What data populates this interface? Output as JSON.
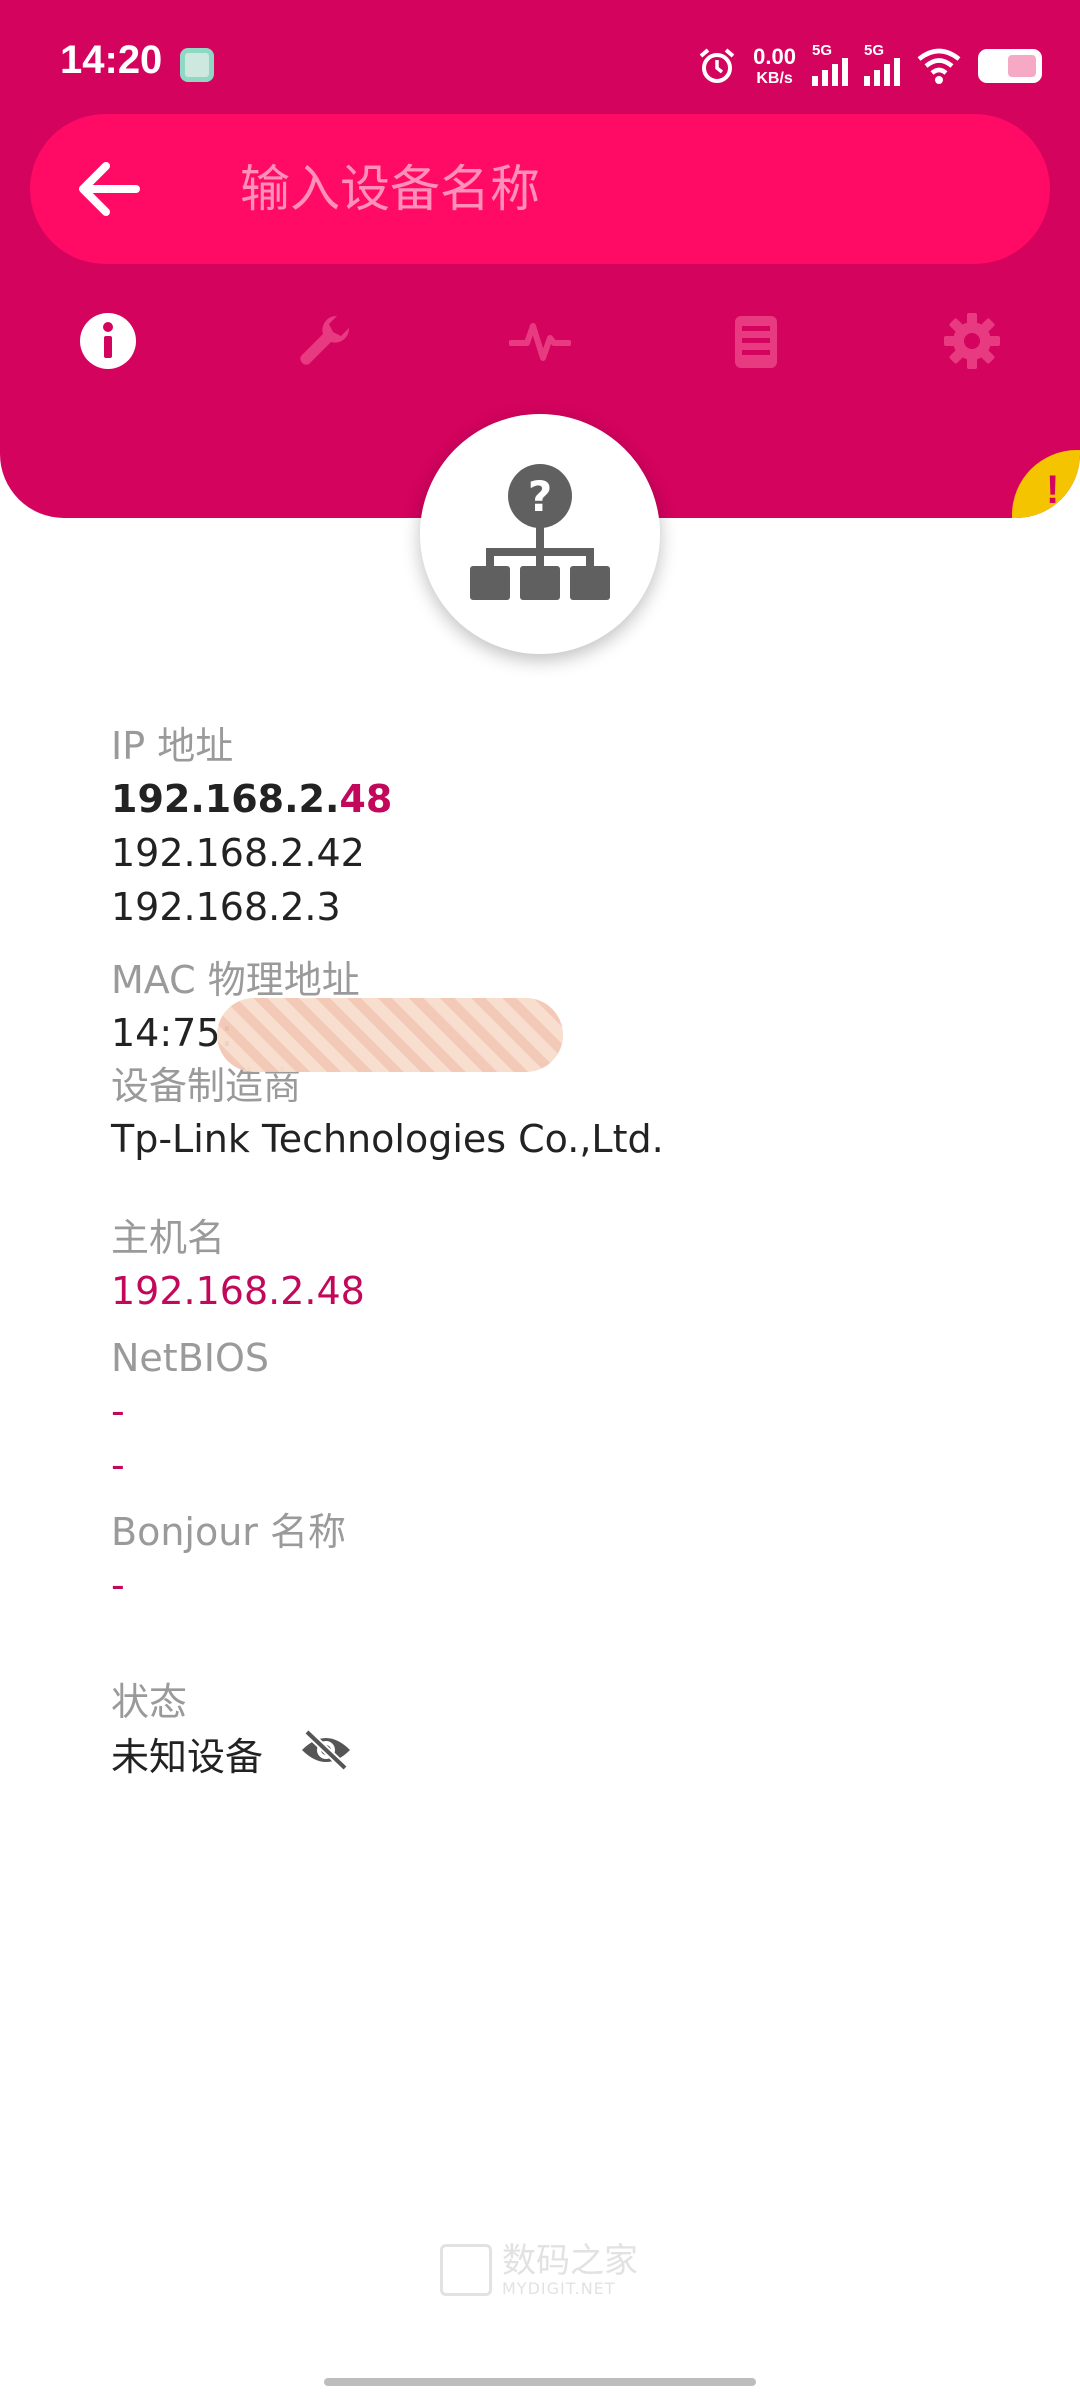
{
  "status_bar": {
    "time": "14:20",
    "net_speed_value": "0.00",
    "net_speed_unit": "KB/s",
    "sim1_label": "5G",
    "sim2_label": "5G"
  },
  "search": {
    "placeholder": "输入设备名称"
  },
  "tabs": [
    {
      "icon": "info-icon",
      "active": true
    },
    {
      "icon": "wrench-icon",
      "active": false
    },
    {
      "icon": "pulse-icon",
      "active": false
    },
    {
      "icon": "list-icon",
      "active": false
    },
    {
      "icon": "gear-icon",
      "active": false
    }
  ],
  "warning_badge": "!",
  "device": {
    "icon": "unknown-network-device-icon",
    "ip_label": "IP 地址",
    "ip_primary_prefix": "192.168.2.",
    "ip_primary_suffix": "48",
    "ip_others": [
      "192.168.2.42",
      "192.168.2.3"
    ],
    "mac_label": "MAC 物理地址",
    "mac_value": "14:75:",
    "vendor_label": "设备制造商",
    "vendor_value": "Tp-Link Technologies Co.,Ltd.",
    "hostname_label": "主机名",
    "hostname_value": "192.168.2.48",
    "netbios_label": "NetBIOS",
    "netbios_values": [
      "-",
      "-"
    ],
    "bonjour_label": "Bonjour 名称",
    "bonjour_value": "-",
    "state_label": "状态",
    "state_value": "未知设备"
  },
  "watermark": {
    "title": "数码之家",
    "subtitle": "MYDIGIT.NET"
  },
  "colors": {
    "header": "#d4035e",
    "searchbar": "#ff0a64",
    "accent_text": "#c2085a",
    "warning": "#f5c400"
  }
}
